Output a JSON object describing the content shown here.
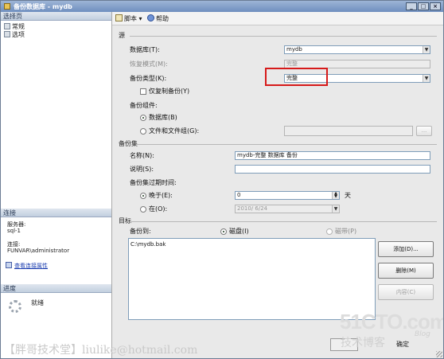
{
  "window": {
    "title": "备份数据库 - mydb",
    "controls": [
      "_",
      "□",
      "×"
    ]
  },
  "left": {
    "select_page_header": "选择页",
    "pages": [
      {
        "label": "常规",
        "icon": "page-icon"
      },
      {
        "label": "选项",
        "icon": "page-icon"
      }
    ],
    "connection_header": "连接",
    "server_label": "服务器:",
    "server_value": "sql-1",
    "connection_label": "连接:",
    "connection_value": "FUNVAR\\administrator",
    "view_link": "查看连接属性",
    "progress_header": "进度",
    "progress_status": "就绪"
  },
  "toolbar": {
    "script_label": "脚本",
    "help_label": "帮助"
  },
  "source": {
    "group_label": "源",
    "database_label": "数据库(T):",
    "database_value": "mydb",
    "recovery_label": "恢复模式(M):",
    "recovery_value": "完整",
    "backup_type_label": "备份类型(K):",
    "backup_type_value": "完整",
    "copy_only_label": "仅复制备份(Y)",
    "component_label": "备份组件:",
    "comp_database_label": "数据库(B)",
    "comp_files_label": "文件和文件组(G):",
    "files_browse": "..."
  },
  "backup_set": {
    "group_label": "备份集",
    "name_label": "名称(N):",
    "name_value": "mydb-完整 数据库 备份",
    "desc_label": "说明(S):",
    "desc_value": "",
    "expire_label": "备份集过期时间:",
    "after_label": "晚于(E):",
    "after_value": "0",
    "days_label": "天",
    "on_label": "在(O):",
    "on_value": "2010/ 6/24"
  },
  "destination": {
    "group_label": "目标",
    "backup_to_label": "备份到:",
    "disk_label": "磁盘(I)",
    "tape_label": "磁带(P)",
    "paths": [
      "C:\\mydb.bak"
    ],
    "add_button": "添加(D)...",
    "remove_button": "删除(M)",
    "contents_button": "内容(C)"
  },
  "footer": {
    "ok_button": "确定"
  },
  "watermark": {
    "left_text": "【胖哥技术堂】liulike@hotmail.com",
    "logo_text": "51CTO.com",
    "logo_sub": "技术博客",
    "blog_text": "Blog"
  }
}
